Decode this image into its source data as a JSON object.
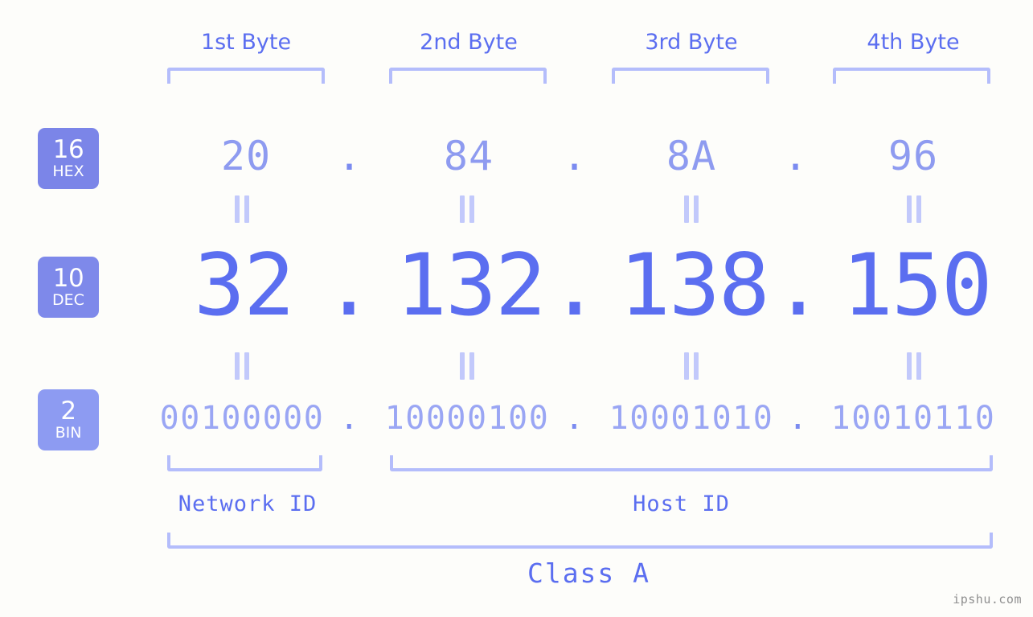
{
  "background_color": "#fdfdfa",
  "accent_color": "#5b6ef0",
  "accent_light_color": "#8e9bf0",
  "bracket_color": "#b4bdfb",
  "byte_headers": [
    {
      "label": "1st Byte"
    },
    {
      "label": "2nd Byte"
    },
    {
      "label": "3rd Byte"
    },
    {
      "label": "4th Byte"
    }
  ],
  "bases": [
    {
      "number": "16",
      "name": "HEX",
      "badge_color": "#7b85e8"
    },
    {
      "number": "10",
      "name": "DEC",
      "badge_color": "#7e89ea"
    },
    {
      "number": "2",
      "name": "BIN",
      "badge_color": "#8d9bf2"
    }
  ],
  "rows": {
    "hex": {
      "base_number": "16",
      "base_name": "HEX",
      "octets": [
        "20",
        "84",
        "8A",
        "96"
      ],
      "separator": "."
    },
    "dec": {
      "base_number": "10",
      "base_name": "DEC",
      "octets": [
        "32",
        "132",
        "138",
        "150"
      ],
      "separator": "."
    },
    "bin": {
      "base_number": "2",
      "base_name": "BIN",
      "octets": [
        "00100000",
        "10000100",
        "10001010",
        "10010110"
      ],
      "separator": "."
    }
  },
  "equality_marks": {
    "glyph": "||",
    "count_per_gap": 4,
    "rows": 2
  },
  "sections": [
    {
      "label": "Network ID"
    },
    {
      "label": "Host ID"
    }
  ],
  "class": {
    "label": "Class A"
  },
  "watermark": {
    "text": "ipshu.com"
  }
}
